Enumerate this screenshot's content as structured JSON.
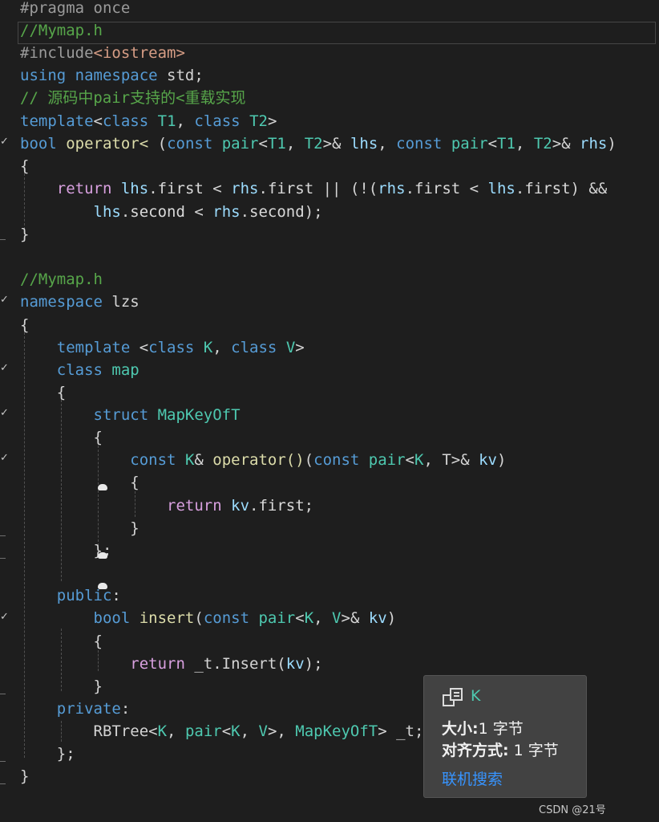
{
  "editor": {
    "lines": [
      "#pragma once",
      "//Mymap.h",
      "#include<iostream>",
      "using namespace std;",
      "// 源码中pair支持的<重载实现",
      "template<class T1, class T2>",
      "bool operator< (const pair<T1, T2>& lhs, const pair<T1, T2>& rhs)",
      "{",
      "    return lhs.first < rhs.first || (!(rhs.first < lhs.first) &&",
      "        lhs.second < rhs.second);",
      "}",
      "",
      "//Mymap.h",
      "namespace lzs",
      "{",
      "    template <class K, class V>",
      "    class map",
      "    {",
      "        struct MapKeyOfT",
      "        {",
      "            const K& operator()(const pair<K, T>& kv)",
      "            {",
      "                return kv.first;",
      "            }",
      "        };",
      "",
      "    public:",
      "        bool insert(const pair<K, V>& kv)",
      "        {",
      "            return _t.Insert(kv);",
      "        }",
      "    private:",
      "        RBTree<K, pair<K, V>, MapKeyOfT> _t;",
      "    };",
      "}"
    ]
  },
  "tooltip": {
    "icon": "template-parameter-icon",
    "name": "K",
    "size_label": "大小:",
    "size_value": "1 字节",
    "align_label": "对齐方式:",
    "align_value": "1 字节",
    "link": "联机搜索"
  },
  "watermark": "CSDN @21号",
  "colors": {
    "background": "#1e1e1e",
    "keyword": "#569cd6",
    "control": "#d8a0df",
    "type": "#4ec9b0",
    "comment": "#57a64a",
    "parameter": "#9cdcfe",
    "function": "#dcdcaa"
  }
}
